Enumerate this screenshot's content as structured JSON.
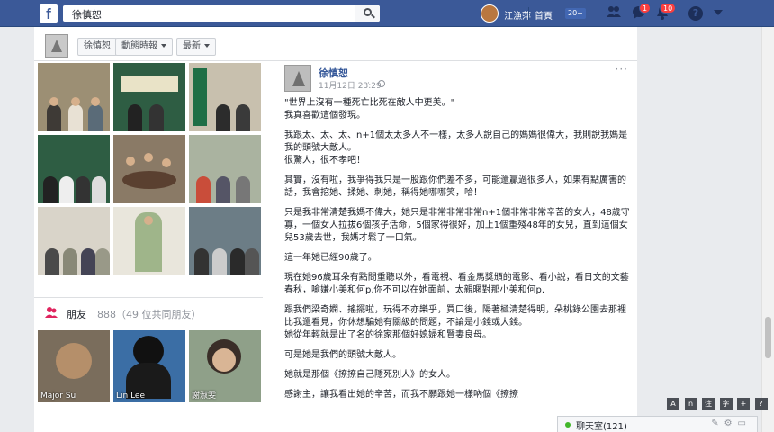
{
  "topbar": {
    "logo": "f",
    "search_value": "徐慎恕",
    "user_name": "江漁萍",
    "home_label": "首頁",
    "home_count": "20+",
    "friend_requests_badge": "1",
    "notifications_badge": "10",
    "help_label": "?"
  },
  "profile_nav": {
    "tabs": [
      "徐慎恕",
      "動態時報",
      "最新"
    ]
  },
  "friends": {
    "title": "朋友",
    "count": "888（49 位共同朋友）",
    "names": [
      "Major Su",
      "Lin Lee",
      "謝淑雯"
    ]
  },
  "post": {
    "author": "徐慎恕",
    "time": "11月12日 23:29",
    "dot": "·",
    "paragraphs": [
      "\"世界上沒有一種死亡比死在敵人中更美。\"\n我真喜歡這個發現。",
      "我跟太、太、太、n+1個太太多人不一樣，太多人說自己的媽媽很偉大，我則說我媽是我的頭號大敵人。\n很驚人，很不孝吧！",
      "其實，沒有啦，我爭得我只是一股跟你們差不多，可能還贏過很多人，如果有點厲害的話，我會挖她、揉她、刺她，稱得她哪哪笑，哈！",
      "只是我非常清楚我媽不偉大，她只是非常非常非常n+1個非常非常辛苦的女人，48歲守寡，一個女人拉拔6個孩子活命，5個家得很好，加上1個重殘48年的女兒，直到這個女兒53歲去世，我媽才鬆了一口氣。",
      "這一年她已經90歲了。",
      "現在她96歲耳朵有點問重聽以外，看電視、看金馬獎頒的電影、看小說，看日文的文藝春秋，喻嫌小美和何p.你不可以在她面前，太親暱對那小美和何p.",
      "跟我們梁奇嫻、搖擺啦，玩得不亦樂乎，買口後，陽著極清楚得明，朵桃錄公園去那裡比我還看見，你休想騙她有關級的問題，不論是小錢或大錢。\n她從年輕就是出了名的徐家那個好媳婦和賢妻良母。",
      "可是她是我們的頭號大敵人。",
      "她就是那個《撩撩自己隱死別人》的女人。",
      "感謝主，讓我看出她的辛苦，而我不願跟她一樣吶個《撩撩"
    ]
  },
  "chat": {
    "label": "聊天室(121)",
    "tools": [
      "A",
      "ñ",
      "注",
      "字",
      "+",
      "?"
    ]
  }
}
